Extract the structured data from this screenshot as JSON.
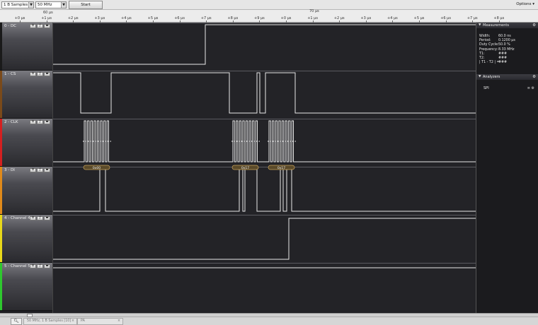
{
  "toolbar": {
    "samples_value": "1 B Samples",
    "rate_value": "50 MHz",
    "start_label": "Start",
    "options_label": "Options"
  },
  "ruler": {
    "start_time": "60 µs",
    "center_time": "70 µs",
    "ticks": [
      "+0 µs",
      "+1 µs",
      "+2 µs",
      "+3 µs",
      "+4 µs",
      "+5 µs",
      "+6 µs",
      "+7 µs",
      "+8 µs",
      "+9 µs",
      "+0 µs",
      "+1 µs",
      "+2 µs",
      "+3 µs",
      "+4 µs",
      "+5 µs",
      "+6 µs",
      "+7 µs",
      "+8 µs"
    ]
  },
  "channels": [
    {
      "label": "0 - DC",
      "color": "#1a1a1a"
    },
    {
      "label": "1 - CS",
      "color": "#7a4a1a"
    },
    {
      "label": "2 - CLK",
      "color": "#d42020"
    },
    {
      "label": "3 - DI",
      "color": "#e08a1a"
    },
    {
      "label": "4 - Channel 4",
      "color": "#e8d81a"
    },
    {
      "label": "5 - Channel 5",
      "color": "#2ec82e"
    }
  ],
  "channel_button_icons": [
    "settings-icon",
    "trigger-icon",
    "collapse-icon"
  ],
  "decoded_bytes": [
    "0x00",
    "0x17",
    "0x17"
  ],
  "measurements": {
    "header": "Measurements",
    "rows": [
      {
        "label": "Width:",
        "value": "60.0 ns"
      },
      {
        "label": "Period:",
        "value": "0.1200 µs"
      },
      {
        "label": "Duty Cycle:",
        "value": "50.0 %"
      },
      {
        "label": "Frequency:",
        "value": "8.33 MHz"
      },
      {
        "label": "T1:",
        "value": "###"
      },
      {
        "label": "T2:",
        "value": "###"
      },
      {
        "label": "| T1 - T2 | =",
        "value": "###"
      }
    ]
  },
  "analyzers": {
    "header": "Analyzers",
    "items": [
      {
        "label": "SPI"
      }
    ]
  },
  "tabs": [
    {
      "label": "50 MHz, 1 B Samples [10]"
    },
    {
      "label": "PA"
    }
  ]
}
